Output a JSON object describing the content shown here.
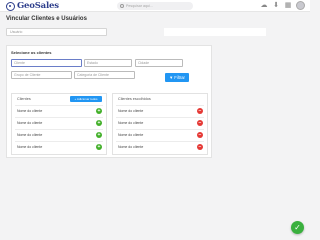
{
  "app": {
    "brand": "GeoSales"
  },
  "topbar": {
    "search_placeholder": "Pesquisar aqui...",
    "icons": [
      "cloud-icon",
      "download-icon",
      "grid-icon",
      "user-avatar"
    ]
  },
  "page": {
    "title": "Vincular Clientes e Usuários"
  },
  "selector": {
    "placeholder": "Usuário"
  },
  "filters": {
    "title": "Selecione os clientes",
    "fields": [
      {
        "placeholder": "Cliente"
      },
      {
        "placeholder": "Estado"
      },
      {
        "placeholder": "Cidade"
      },
      {
        "placeholder": "Grupo de Cliente"
      },
      {
        "placeholder": "Categoria de Cliente"
      }
    ],
    "filter_button": "Filtrar",
    "filter_icon": "funnel-icon"
  },
  "clients_panel": {
    "title": "Clientes",
    "add_all_label": "+ Adicionar todos",
    "rows": [
      "Nome do cliente",
      "Nome do cliente",
      "Nome do cliente",
      "Nome do cliente"
    ]
  },
  "chosen_panel": {
    "title": "Clientes escolhidos",
    "rows": [
      "Nome do cliente",
      "Nome do cliente",
      "Nome do cliente",
      "Nome do cliente"
    ]
  },
  "colors": {
    "accent": "#2196f3",
    "brand": "#2d3e8c",
    "add": "#43b02a",
    "remove": "#e53935",
    "confirm": "#3ab03e"
  },
  "actions": {
    "add_symbol": "+",
    "remove_symbol": "−",
    "confirm_symbol": "✓"
  }
}
